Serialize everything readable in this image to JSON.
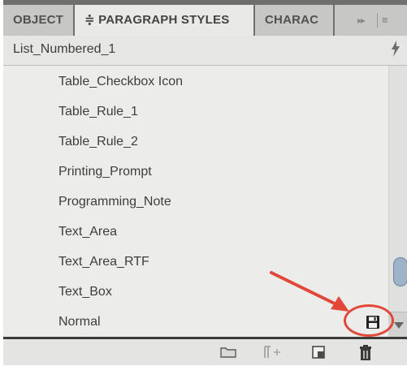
{
  "tabs": [
    {
      "label": "OBJECT"
    },
    {
      "label": "≑ PARAGRAPH STYLES"
    },
    {
      "label": "CHARAC"
    }
  ],
  "tab_more": {
    "arrows": "▸▸",
    "menu": "≡"
  },
  "current_style": {
    "name": "List_Numbered_1",
    "icon": "lightning-icon"
  },
  "styles": [
    {
      "label": "Table_Checkbox Icon"
    },
    {
      "label": "Table_Rule_1"
    },
    {
      "label": "Table_Rule_2"
    },
    {
      "label": "Printing_Prompt"
    },
    {
      "label": "Programming_Note"
    },
    {
      "label": "Text_Area"
    },
    {
      "label": "Text_Area_RTF"
    },
    {
      "label": "Text_Box"
    },
    {
      "label": "Normal"
    }
  ],
  "toolbar": {
    "icons": [
      "folder-icon",
      "clear-overrides-icon",
      "new-style-icon",
      "delete-icon"
    ]
  },
  "annotation": {
    "color": "#e2483a",
    "target_icon": "save-icon"
  }
}
